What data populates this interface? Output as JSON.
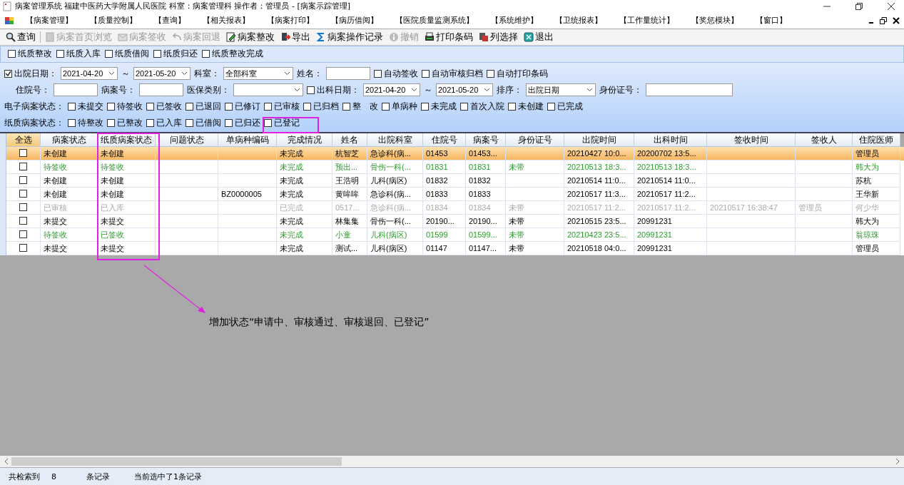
{
  "window": {
    "title": "病案管理系统  福建中医药大学附属人民医院  科室：病案管理科 操作者：管理员 - [病案示踪管理]"
  },
  "menu": [
    "【病案管理】",
    "【质量控制】",
    "【查询】",
    "【相关报表】",
    "【病案打印】",
    "【病历借阅】",
    "【医院质量监测系统】",
    "【系统维护】",
    "【卫统报表】",
    "【工作量统计】",
    "【奖惩模块】",
    "【窗口】"
  ],
  "toolbar": [
    {
      "label": "查询",
      "disabled": false
    },
    {
      "label": "病案首页浏览",
      "disabled": true
    },
    {
      "label": "病案签收",
      "disabled": true
    },
    {
      "label": "病案回退",
      "disabled": true
    },
    {
      "label": "病案整改",
      "disabled": false
    },
    {
      "label": "导出",
      "disabled": false
    },
    {
      "label": "病案操作记录",
      "disabled": false
    },
    {
      "label": "撤销",
      "disabled": true
    },
    {
      "label": "打印条码",
      "disabled": false
    },
    {
      "label": "列选择",
      "disabled": false
    },
    {
      "label": "退出",
      "disabled": false
    }
  ],
  "paper_actions": [
    {
      "label": "纸质整改",
      "checked": false
    },
    {
      "label": "纸质入库",
      "checked": false
    },
    {
      "label": "纸质借阅",
      "checked": false
    },
    {
      "label": "纸质归还",
      "checked": false
    },
    {
      "label": "纸质整改完成",
      "checked": false
    }
  ],
  "filters": [
    [
      {
        "kind": "checkbox",
        "label": "出院日期：",
        "checked": true
      },
      {
        "kind": "date",
        "value": "2021-04-20"
      },
      {
        "kind": "label",
        "text": "～"
      },
      {
        "kind": "date",
        "value": "2021-05-20"
      },
      {
        "kind": "label",
        "text": "科室："
      },
      {
        "kind": "select",
        "value": "全部科室"
      },
      {
        "kind": "label",
        "text": "姓名："
      },
      {
        "kind": "input"
      },
      {
        "kind": "checkbox",
        "label": "自动签收",
        "checked": false
      },
      {
        "kind": "checkbox",
        "label": "自动审核归档",
        "checked": false
      },
      {
        "kind": "checkbox",
        "label": "自动打印条码",
        "checked": false
      }
    ],
    [
      {
        "kind": "label",
        "text": "住院号："
      },
      {
        "kind": "input"
      },
      {
        "kind": "label",
        "text": "病案号："
      },
      {
        "kind": "input"
      },
      {
        "kind": "label",
        "text": "医保类别："
      },
      {
        "kind": "select"
      },
      {
        "kind": "checkbox",
        "label": "出科日期：",
        "checked": false
      },
      {
        "kind": "date",
        "value": "2021-04-20"
      },
      {
        "kind": "label",
        "text": "～"
      },
      {
        "kind": "date",
        "value": "2021-05-20"
      },
      {
        "kind": "label",
        "text": "排序："
      },
      {
        "kind": "select",
        "value": "出院日期"
      },
      {
        "kind": "label",
        "text": "身份证号："
      },
      {
        "kind": "wide_input"
      }
    ],
    [
      {
        "kind": "label",
        "text": "电子病案状态："
      },
      {
        "kind": "checkbox",
        "label": "未提交",
        "checked": false
      },
      {
        "kind": "checkbox",
        "label": "待签收",
        "checked": false
      },
      {
        "kind": "checkbox",
        "label": "已签收",
        "checked": false
      },
      {
        "kind": "checkbox",
        "label": "已退回",
        "checked": false
      },
      {
        "kind": "checkbox",
        "label": "已修订",
        "checked": false
      },
      {
        "kind": "checkbox",
        "label": "已审核",
        "checked": false
      },
      {
        "kind": "checkbox",
        "label": "已归档",
        "checked": false
      },
      {
        "kind": "checkbox",
        "label": "整　改",
        "checked": false
      },
      {
        "kind": "checkbox",
        "label": "单病种",
        "checked": false
      },
      {
        "kind": "checkbox",
        "label": "未完成",
        "checked": false
      },
      {
        "kind": "checkbox",
        "label": "首次入院",
        "checked": false
      },
      {
        "kind": "checkbox",
        "label": "未创建",
        "checked": false
      },
      {
        "kind": "checkbox",
        "label": "已完成",
        "checked": false
      }
    ],
    [
      {
        "kind": "label",
        "text": "纸质病案状态："
      },
      {
        "kind": "checkbox",
        "label": "待整改",
        "checked": false
      },
      {
        "kind": "checkbox",
        "label": "已整改",
        "checked": false
      },
      {
        "kind": "checkbox",
        "label": "已入库",
        "checked": false
      },
      {
        "kind": "checkbox",
        "label": "已借阅",
        "checked": false
      },
      {
        "kind": "checkbox",
        "label": "已归还",
        "checked": false
      },
      {
        "kind": "checkbox",
        "label": "已登记",
        "checked": false
      }
    ]
  ],
  "table": {
    "select_all": "全选",
    "columns": [
      "病案状态",
      "纸质病案状态",
      "问题状态",
      "单病种编码",
      "完成情况",
      "姓名",
      "出院科室",
      "住院号",
      "病案号",
      "身份证号",
      "出院时间",
      "出科时间",
      "签收时间",
      "签收人",
      "住院医师"
    ],
    "rows": [
      {
        "selected": true,
        "highlighted": false,
        "disabled": false,
        "checked": false,
        "cells": [
          "未创建",
          "未创建",
          "",
          "",
          "未完成",
          "杭智芝",
          "急诊科(病...",
          "01453",
          "01453...",
          "",
          "20210427 10:0...",
          "20200702 13:5...",
          "",
          "",
          "管理员"
        ]
      },
      {
        "selected": false,
        "highlighted": true,
        "disabled": false,
        "checked": false,
        "cells": [
          "待签收",
          "待签收",
          "",
          "",
          "未完成",
          "预出...",
          "骨伤一科(...",
          "01831",
          "01831",
          "未带",
          "20210513 18:3...",
          "20210513 18:3...",
          "",
          "",
          "韩大为"
        ]
      },
      {
        "selected": false,
        "highlighted": false,
        "disabled": false,
        "checked": false,
        "cells": [
          "未创建",
          "未创建",
          "",
          "",
          "未完成",
          "王浩明",
          "儿科(病区)",
          "01832",
          "01832",
          "",
          "20210514 11:0...",
          "20210514 11:0...",
          "",
          "",
          "苏杭"
        ]
      },
      {
        "selected": false,
        "highlighted": false,
        "disabled": false,
        "checked": false,
        "cells": [
          "未创建",
          "未创建",
          "",
          "BZ0000005",
          "未完成",
          "黄哞哞",
          "急诊科(病...",
          "01833",
          "01833",
          "",
          "20210517 11:3...",
          "20210517 11:2...",
          "",
          "",
          "王华新"
        ]
      },
      {
        "selected": false,
        "highlighted": false,
        "disabled": true,
        "checked": false,
        "cells": [
          "已审核",
          "已入库",
          "",
          "",
          "已完成",
          "0517...",
          "急诊科(病...",
          "01834",
          "01834",
          "未带",
          "20210517 11:2...",
          "20210517 11:2...",
          "20210517 16:38:47",
          "管理员",
          "何少华"
        ]
      },
      {
        "selected": false,
        "highlighted": false,
        "disabled": false,
        "checked": false,
        "cells": [
          "未提交",
          "未提交",
          "",
          "",
          "未完成",
          "林集集",
          "骨伤一科(...",
          "20190...",
          "20190...",
          "未带",
          "20210515 23:5...",
          "20991231",
          "",
          "",
          "韩大为"
        ]
      },
      {
        "selected": false,
        "highlighted": true,
        "disabled": false,
        "checked": false,
        "cells": [
          "待签收",
          "已签收",
          "",
          "",
          "未完成",
          "小童",
          "儿科(病区)",
          "01599",
          "01599...",
          "未带",
          "20210423 23:5...",
          "20991231",
          "",
          "",
          "翁琼珠"
        ]
      },
      {
        "selected": false,
        "highlighted": false,
        "disabled": false,
        "checked": false,
        "cells": [
          "未提交",
          "未提交",
          "",
          "",
          "未完成",
          "测试...",
          "儿科(病区)",
          "01147",
          "01147...",
          "未带",
          "20210518 04:0...",
          "20991231",
          "",
          "",
          "管理员"
        ]
      }
    ]
  },
  "annotation": {
    "text": "增加状态“申请中、审核通过、审核退回、已登记”"
  },
  "status_bar": {
    "label": "共检索到",
    "count": "8",
    "unit": "条记录",
    "selection": "当前选中了1条记录"
  }
}
